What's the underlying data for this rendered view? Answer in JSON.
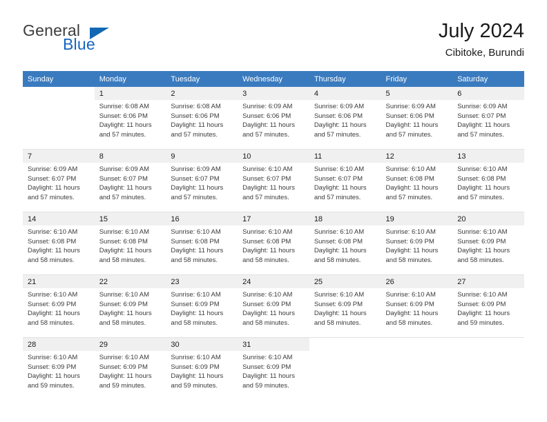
{
  "brand": {
    "name_part1": "General",
    "name_part2": "Blue",
    "flag_icon": "triangle-flag-icon"
  },
  "header": {
    "title": "July 2024",
    "location": "Cibitoke, Burundi"
  },
  "colors": {
    "header_row_background": "#3a7bbf",
    "header_row_text": "#ffffff",
    "brand_blue": "#1565c0",
    "day_number_background": "#f0f0f0",
    "cell_border": "#e2e2e2",
    "page_background": "#ffffff"
  },
  "weekdays": [
    "Sunday",
    "Monday",
    "Tuesday",
    "Wednesday",
    "Thursday",
    "Friday",
    "Saturday"
  ],
  "weeks": [
    [
      {
        "day": "",
        "sunrise": "",
        "sunset": "",
        "daylight_line1": "",
        "daylight_line2": ""
      },
      {
        "day": "1",
        "sunrise": "Sunrise: 6:08 AM",
        "sunset": "Sunset: 6:06 PM",
        "daylight_line1": "Daylight: 11 hours",
        "daylight_line2": "and 57 minutes."
      },
      {
        "day": "2",
        "sunrise": "Sunrise: 6:08 AM",
        "sunset": "Sunset: 6:06 PM",
        "daylight_line1": "Daylight: 11 hours",
        "daylight_line2": "and 57 minutes."
      },
      {
        "day": "3",
        "sunrise": "Sunrise: 6:09 AM",
        "sunset": "Sunset: 6:06 PM",
        "daylight_line1": "Daylight: 11 hours",
        "daylight_line2": "and 57 minutes."
      },
      {
        "day": "4",
        "sunrise": "Sunrise: 6:09 AM",
        "sunset": "Sunset: 6:06 PM",
        "daylight_line1": "Daylight: 11 hours",
        "daylight_line2": "and 57 minutes."
      },
      {
        "day": "5",
        "sunrise": "Sunrise: 6:09 AM",
        "sunset": "Sunset: 6:06 PM",
        "daylight_line1": "Daylight: 11 hours",
        "daylight_line2": "and 57 minutes."
      },
      {
        "day": "6",
        "sunrise": "Sunrise: 6:09 AM",
        "sunset": "Sunset: 6:07 PM",
        "daylight_line1": "Daylight: 11 hours",
        "daylight_line2": "and 57 minutes."
      }
    ],
    [
      {
        "day": "7",
        "sunrise": "Sunrise: 6:09 AM",
        "sunset": "Sunset: 6:07 PM",
        "daylight_line1": "Daylight: 11 hours",
        "daylight_line2": "and 57 minutes."
      },
      {
        "day": "8",
        "sunrise": "Sunrise: 6:09 AM",
        "sunset": "Sunset: 6:07 PM",
        "daylight_line1": "Daylight: 11 hours",
        "daylight_line2": "and 57 minutes."
      },
      {
        "day": "9",
        "sunrise": "Sunrise: 6:09 AM",
        "sunset": "Sunset: 6:07 PM",
        "daylight_line1": "Daylight: 11 hours",
        "daylight_line2": "and 57 minutes."
      },
      {
        "day": "10",
        "sunrise": "Sunrise: 6:10 AM",
        "sunset": "Sunset: 6:07 PM",
        "daylight_line1": "Daylight: 11 hours",
        "daylight_line2": "and 57 minutes."
      },
      {
        "day": "11",
        "sunrise": "Sunrise: 6:10 AM",
        "sunset": "Sunset: 6:07 PM",
        "daylight_line1": "Daylight: 11 hours",
        "daylight_line2": "and 57 minutes."
      },
      {
        "day": "12",
        "sunrise": "Sunrise: 6:10 AM",
        "sunset": "Sunset: 6:08 PM",
        "daylight_line1": "Daylight: 11 hours",
        "daylight_line2": "and 57 minutes."
      },
      {
        "day": "13",
        "sunrise": "Sunrise: 6:10 AM",
        "sunset": "Sunset: 6:08 PM",
        "daylight_line1": "Daylight: 11 hours",
        "daylight_line2": "and 57 minutes."
      }
    ],
    [
      {
        "day": "14",
        "sunrise": "Sunrise: 6:10 AM",
        "sunset": "Sunset: 6:08 PM",
        "daylight_line1": "Daylight: 11 hours",
        "daylight_line2": "and 58 minutes."
      },
      {
        "day": "15",
        "sunrise": "Sunrise: 6:10 AM",
        "sunset": "Sunset: 6:08 PM",
        "daylight_line1": "Daylight: 11 hours",
        "daylight_line2": "and 58 minutes."
      },
      {
        "day": "16",
        "sunrise": "Sunrise: 6:10 AM",
        "sunset": "Sunset: 6:08 PM",
        "daylight_line1": "Daylight: 11 hours",
        "daylight_line2": "and 58 minutes."
      },
      {
        "day": "17",
        "sunrise": "Sunrise: 6:10 AM",
        "sunset": "Sunset: 6:08 PM",
        "daylight_line1": "Daylight: 11 hours",
        "daylight_line2": "and 58 minutes."
      },
      {
        "day": "18",
        "sunrise": "Sunrise: 6:10 AM",
        "sunset": "Sunset: 6:08 PM",
        "daylight_line1": "Daylight: 11 hours",
        "daylight_line2": "and 58 minutes."
      },
      {
        "day": "19",
        "sunrise": "Sunrise: 6:10 AM",
        "sunset": "Sunset: 6:09 PM",
        "daylight_line1": "Daylight: 11 hours",
        "daylight_line2": "and 58 minutes."
      },
      {
        "day": "20",
        "sunrise": "Sunrise: 6:10 AM",
        "sunset": "Sunset: 6:09 PM",
        "daylight_line1": "Daylight: 11 hours",
        "daylight_line2": "and 58 minutes."
      }
    ],
    [
      {
        "day": "21",
        "sunrise": "Sunrise: 6:10 AM",
        "sunset": "Sunset: 6:09 PM",
        "daylight_line1": "Daylight: 11 hours",
        "daylight_line2": "and 58 minutes."
      },
      {
        "day": "22",
        "sunrise": "Sunrise: 6:10 AM",
        "sunset": "Sunset: 6:09 PM",
        "daylight_line1": "Daylight: 11 hours",
        "daylight_line2": "and 58 minutes."
      },
      {
        "day": "23",
        "sunrise": "Sunrise: 6:10 AM",
        "sunset": "Sunset: 6:09 PM",
        "daylight_line1": "Daylight: 11 hours",
        "daylight_line2": "and 58 minutes."
      },
      {
        "day": "24",
        "sunrise": "Sunrise: 6:10 AM",
        "sunset": "Sunset: 6:09 PM",
        "daylight_line1": "Daylight: 11 hours",
        "daylight_line2": "and 58 minutes."
      },
      {
        "day": "25",
        "sunrise": "Sunrise: 6:10 AM",
        "sunset": "Sunset: 6:09 PM",
        "daylight_line1": "Daylight: 11 hours",
        "daylight_line2": "and 58 minutes."
      },
      {
        "day": "26",
        "sunrise": "Sunrise: 6:10 AM",
        "sunset": "Sunset: 6:09 PM",
        "daylight_line1": "Daylight: 11 hours",
        "daylight_line2": "and 58 minutes."
      },
      {
        "day": "27",
        "sunrise": "Sunrise: 6:10 AM",
        "sunset": "Sunset: 6:09 PM",
        "daylight_line1": "Daylight: 11 hours",
        "daylight_line2": "and 59 minutes."
      }
    ],
    [
      {
        "day": "28",
        "sunrise": "Sunrise: 6:10 AM",
        "sunset": "Sunset: 6:09 PM",
        "daylight_line1": "Daylight: 11 hours",
        "daylight_line2": "and 59 minutes."
      },
      {
        "day": "29",
        "sunrise": "Sunrise: 6:10 AM",
        "sunset": "Sunset: 6:09 PM",
        "daylight_line1": "Daylight: 11 hours",
        "daylight_line2": "and 59 minutes."
      },
      {
        "day": "30",
        "sunrise": "Sunrise: 6:10 AM",
        "sunset": "Sunset: 6:09 PM",
        "daylight_line1": "Daylight: 11 hours",
        "daylight_line2": "and 59 minutes."
      },
      {
        "day": "31",
        "sunrise": "Sunrise: 6:10 AM",
        "sunset": "Sunset: 6:09 PM",
        "daylight_line1": "Daylight: 11 hours",
        "daylight_line2": "and 59 minutes."
      },
      {
        "day": "",
        "sunrise": "",
        "sunset": "",
        "daylight_line1": "",
        "daylight_line2": ""
      },
      {
        "day": "",
        "sunrise": "",
        "sunset": "",
        "daylight_line1": "",
        "daylight_line2": ""
      },
      {
        "day": "",
        "sunrise": "",
        "sunset": "",
        "daylight_line1": "",
        "daylight_line2": ""
      }
    ]
  ]
}
